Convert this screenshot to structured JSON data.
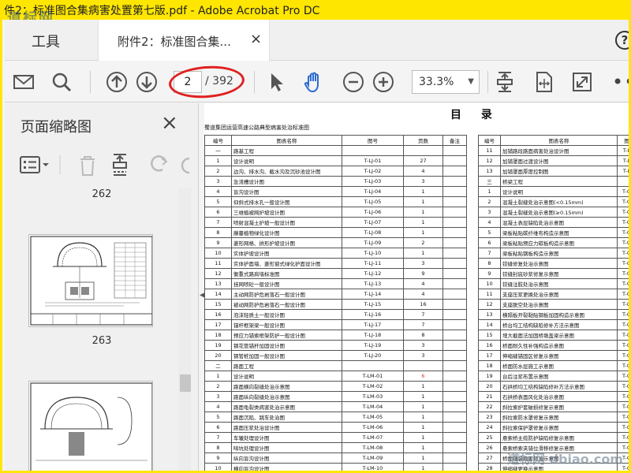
{
  "window": {
    "title": "件2：标准图合集病害处置第七版.pdf - Adobe Acrobat Pro DC",
    "watermark": "道标网"
  },
  "tabs": {
    "tools_label": "工具",
    "doc_label": "附件2：标准图合集...",
    "close_symbol": "×",
    "help_symbol": "?"
  },
  "toolbar": {
    "page_current": "2",
    "page_total": "/ 392",
    "zoom": "33.3%",
    "icons": [
      "envelope-icon",
      "search-icon",
      "page-up-icon",
      "page-down-icon",
      "cursor-icon",
      "hand-icon",
      "zoom-out-icon",
      "zoom-in-icon",
      "fit-page-icon",
      "fit-width-icon",
      "full-screen-icon",
      "more-icon"
    ],
    "highlight_color": "#e02020"
  },
  "sidebar": {
    "title": "页面缩略图",
    "close_symbol": "×",
    "pages": [
      "262",
      "263"
    ]
  },
  "doc": {
    "heading": "目 录",
    "subtitle": "蜀道集团运营高速公路典型病害处治标准图",
    "left_headers": [
      "编号",
      "图表名称",
      "图号",
      "页数",
      "备注"
    ],
    "left_rows": [
      [
        "一",
        "路基工程",
        "",
        ""
      ],
      [
        "1",
        "设计说明",
        "T-LJ-01",
        "27"
      ],
      [
        "2",
        "边沟、排水沟、截水沟及沉砂池设计图",
        "T-LJ-02",
        "4"
      ],
      [
        "3",
        "急流槽设计图",
        "T-LJ-03",
        "3"
      ],
      [
        "4",
        "盲沟设计图",
        "T-LJ-04",
        "1"
      ],
      [
        "5",
        "仰斜式排水孔一般设计图",
        "T-LJ-05",
        "1"
      ],
      [
        "6",
        "三维植被网护坡设计图",
        "T-LJ-06",
        "1"
      ],
      [
        "7",
        "喷射混凝土护坡一般设计图",
        "T-LJ-07",
        "1"
      ],
      [
        "8",
        "藤蔓植物绿化设计图",
        "T-LJ-08",
        "1"
      ],
      [
        "9",
        "菱形网格、拱形护坡设计图",
        "T-LJ-09",
        "2"
      ],
      [
        "10",
        "实体护坡设计图",
        "T-LJ-10",
        "1"
      ],
      [
        "11",
        "实体护面墙、菱形窗式绿化护面设计图",
        "T-LJ-11",
        "3"
      ],
      [
        "12",
        "衡重式路肩墙标准图",
        "T-LJ-12",
        "9"
      ],
      [
        "13",
        "挂网喷砼一般设计图",
        "T-LJ-13",
        "4"
      ],
      [
        "14",
        "主动网防护危岩落石一般设计图",
        "T-LJ-14",
        "4"
      ],
      [
        "15",
        "被动网防护危岩落石一般设计图",
        "T-LJ-15",
        "16"
      ],
      [
        "16",
        "泡沫轻质土一般设计图",
        "T-LJ-16",
        "7"
      ],
      [
        "17",
        "锚杆框架梁一般设计图",
        "T-LJ-17",
        "7"
      ],
      [
        "18",
        "预应力锚索框架防护一般设计图",
        "T-LJ-18",
        "8"
      ],
      [
        "19",
        "钢花管锚杆加固设计图",
        "T-LJ-19",
        "3"
      ],
      [
        "20",
        "钢管桩加固一般设计图",
        "T-LJ-20",
        "3"
      ],
      [
        "二",
        "路面工程",
        "",
        ""
      ],
      [
        "1",
        "设计说明",
        "T-LM-01",
        "6"
      ],
      [
        "2",
        "路面横向裂缝处治示意图",
        "T-LM-02",
        "1"
      ],
      [
        "3",
        "路面纵向裂缝处治示意图",
        "T-LM-03",
        "1"
      ],
      [
        "4",
        "路面龟裂类病害处治示意图",
        "T-LM-04",
        "1"
      ],
      [
        "5",
        "路面沉陷、跳车处治图",
        "T-LM-05",
        "1"
      ],
      [
        "6",
        "路面压浆处治设计图",
        "T-LM-06",
        "1"
      ],
      [
        "7",
        "车辙处理设计图",
        "T-LM-07",
        "1"
      ],
      [
        "8",
        "啃坑处理设计图",
        "T-LM-08",
        "1"
      ],
      [
        "9",
        "纵向盲沟设计图",
        "T-LM-09",
        "1"
      ],
      [
        "10",
        "横向盲沟设计图",
        "T-LM-10",
        "1"
      ]
    ],
    "right_headers": [
      "编号",
      "图表名称",
      "图"
    ],
    "right_rows": [
      [
        "11",
        "加铺路段路面病害处治设计图",
        "T-L"
      ],
      [
        "12",
        "加铺罩面过渡设计图",
        "T-L"
      ],
      [
        "13",
        "加铺罩面厚度控制图",
        "T-L"
      ],
      [
        "三",
        "桥梁工程",
        ""
      ],
      [
        "1",
        "设计说明",
        "T-Q"
      ],
      [
        "2",
        "混凝土裂缝处治示意图(<0.15mm)",
        "T-Q"
      ],
      [
        "3",
        "混凝土裂缝处治示意图(≥0.15mm)",
        "T-Q"
      ],
      [
        "4",
        "混凝土表层缺陷处治示意图",
        "T-Q"
      ],
      [
        "5",
        "梁板粘贴碳纤维布构造示意图",
        "T-Q"
      ],
      [
        "6",
        "梁板粘贴预应力碳板构造示意图",
        "T-Q"
      ],
      [
        "7",
        "梁板粘贴钢板构造示意图",
        "T-Q"
      ],
      [
        "8",
        "铰缝修复处治示意图",
        "T-Q"
      ],
      [
        "9",
        "铰缝封底砂浆修复示意图",
        "T-Q"
      ],
      [
        "10",
        "铰缝注胶处治示意图",
        "T-Q"
      ],
      [
        "11",
        "支座压浆更换处治示意图",
        "T-Q"
      ],
      [
        "12",
        "支座脱空处治示意图",
        "T-Q"
      ],
      [
        "13",
        "横隔板开裂黏贴钢板加固构造示意图",
        "T-Q"
      ],
      [
        "14",
        "桥台均工结构缺陷修补方法示意图",
        "T-Q"
      ],
      [
        "15",
        "增大截面法加固桥墩盖梁示意图",
        "T-Q"
      ],
      [
        "16",
        "桥面耐久性补强构造示意图",
        "T-Q"
      ],
      [
        "17",
        "伸缩缝锚固区修复示意图",
        "T-Q"
      ],
      [
        "18",
        "桥面防水层施工示意图",
        "T-Q"
      ],
      [
        "19",
        "台后注浆布置示意图",
        "T-Q"
      ],
      [
        "20",
        "石拱桥均工结构缺陷修补方法示意图",
        "T-Q"
      ],
      [
        "21",
        "石拱桥表面风化处治示意图",
        "T-Q"
      ],
      [
        "22",
        "斜拉索护套破损修复示意图",
        "T-Q"
      ],
      [
        "23",
        "斜拉索防水罩修复示意图",
        "T-Q"
      ],
      [
        "24",
        "斜拉索保护罩修复示意图",
        "T-Q"
      ],
      [
        "25",
        "悬索桥主缆防护缺陷修复示意图",
        "T-Q"
      ],
      [
        "26",
        "悬索桥索夹错位滑移修复示意图",
        "T-Q"
      ],
      [
        "27",
        "桥面铺装病害处治示意图",
        "T-Q"
      ],
      [
        "28",
        "伸缩缝更换示意图",
        "T-Q"
      ]
    ]
  },
  "bottom_watermark": "道标网 dbiao.com"
}
